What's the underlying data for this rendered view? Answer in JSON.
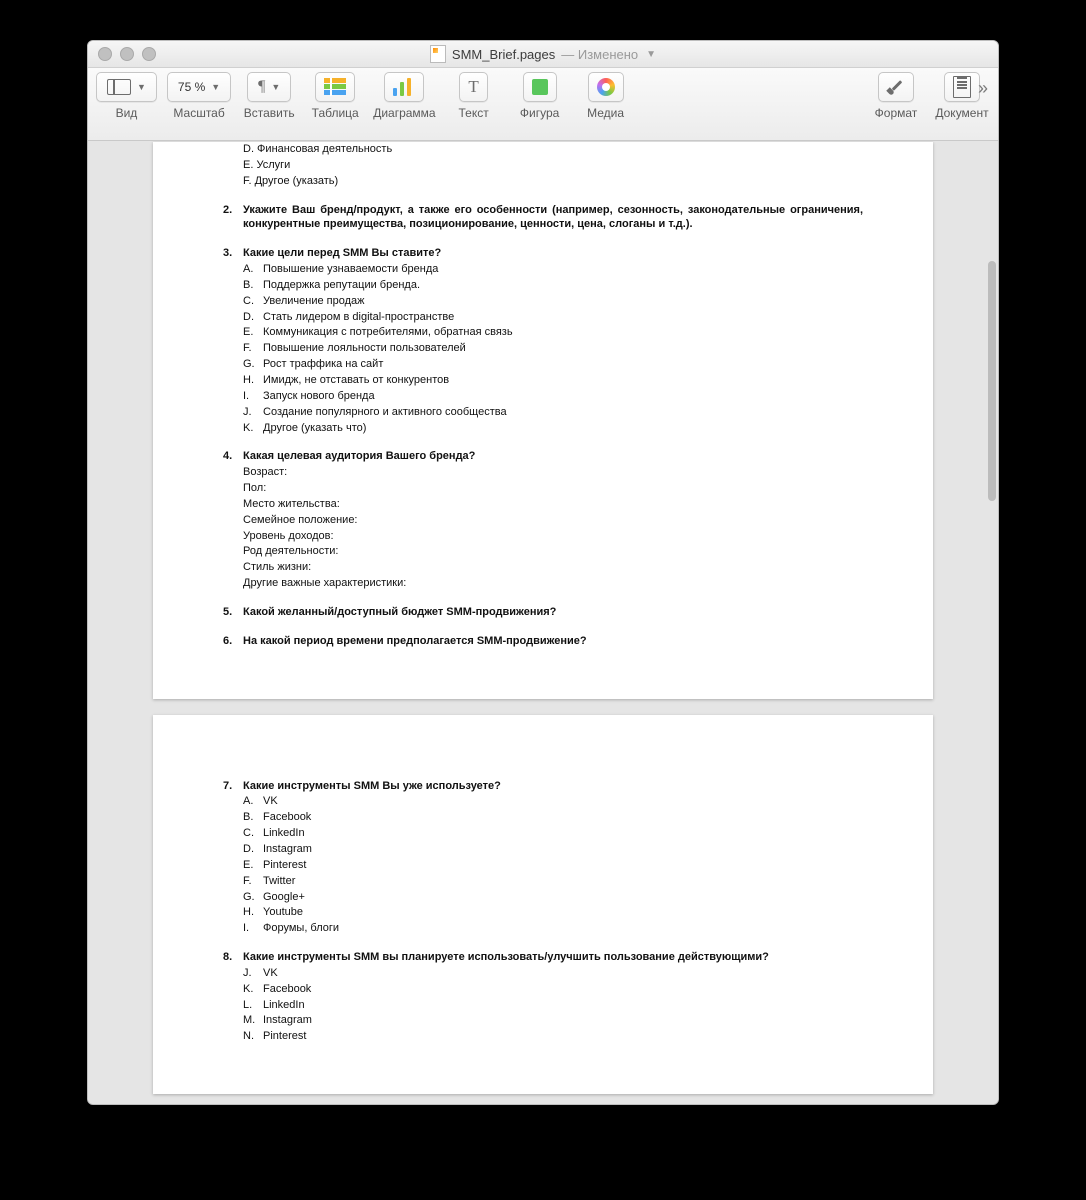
{
  "window": {
    "filename": "SMM_Brief.pages",
    "modified": "— Изменено"
  },
  "toolbar": {
    "view": "Вид",
    "zoom_value": "75 %",
    "zoom_label": "Масштаб",
    "insert": "Вставить",
    "table": "Таблица",
    "chart": "Диаграмма",
    "text": "Текст",
    "shape": "Фигура",
    "media": "Медиа",
    "format": "Формат",
    "document": "Документ"
  },
  "doc": {
    "preD": "D. Финансовая деятельность",
    "preE": "E. Услуги",
    "preF": "F. Другое (указать)",
    "q2": {
      "n": "2.",
      "t": "Укажите Ваш бренд/продукт, а также его особенности (например, сезонность, законодательные ограничения, конкурентные преимущества, позиционирование, ценности, цена, слоганы и т.д.)."
    },
    "q3": {
      "n": "3.",
      "t": "Какие цели перед SMM Вы ставите?",
      "items": [
        {
          "l": "A.",
          "t": "Повышение узнаваемости бренда"
        },
        {
          "l": "B.",
          "t": "Поддержка репутации бренда."
        },
        {
          "l": "C.",
          "t": "Увеличение продаж"
        },
        {
          "l": "D.",
          "t": "Стать лидером в digital-пространстве"
        },
        {
          "l": "E.",
          "t": "Коммуникация с потребителями, обратная связь"
        },
        {
          "l": "F.",
          "t": "Повышение лояльности пользователей"
        },
        {
          "l": "G.",
          "t": "Рост траффика на сайт"
        },
        {
          "l": "H.",
          "t": "Имидж, не отставать от конкурентов"
        },
        {
          "l": "I.",
          "t": "Запуск нового бренда"
        },
        {
          "l": "J.",
          "t": "Создание популярного и активного сообщества"
        },
        {
          "l": "K.",
          "t": "Другое (указать что)"
        }
      ]
    },
    "q4": {
      "n": "4.",
      "t": "Какая целевая аудитория Вашего бренда?",
      "lines": [
        "Возраст:",
        "Пол:",
        "Место жительства:",
        "Семейное положение:",
        "Уровень доходов:",
        "Род деятельности:",
        "Стиль жизни:",
        "Другие важные характеристики:"
      ]
    },
    "q5": {
      "n": "5.",
      "t": "Какой желанный/доступный бюджет SMM-продвижения?"
    },
    "q6": {
      "n": "6.",
      "t": "На какой период времени предполагается SMM-продвижение?"
    },
    "q7": {
      "n": "7.",
      "t": "Какие инструменты SMM Вы уже используете?",
      "items": [
        {
          "l": "A.",
          "t": "VK"
        },
        {
          "l": "B.",
          "t": "Facebook"
        },
        {
          "l": "C.",
          "t": "LinkedIn"
        },
        {
          "l": "D.",
          "t": "Instagram"
        },
        {
          "l": "E.",
          "t": "Pinterest"
        },
        {
          "l": "F.",
          "t": "Twitter"
        },
        {
          "l": "G.",
          "t": "Google+"
        },
        {
          "l": "H.",
          "t": "Youtube"
        },
        {
          "l": "I.",
          "t": "Форумы, блоги"
        }
      ]
    },
    "q8": {
      "n": "8.",
      "t": "Какие инструменты SMM вы планируете использовать/улучшить пользование действующими?",
      "items": [
        {
          "l": "J.",
          "t": "VK"
        },
        {
          "l": "K.",
          "t": "Facebook"
        },
        {
          "l": "L.",
          "t": "LinkedIn"
        },
        {
          "l": "M.",
          "t": "Instagram"
        },
        {
          "l": "N.",
          "t": "Pinterest"
        }
      ]
    }
  }
}
